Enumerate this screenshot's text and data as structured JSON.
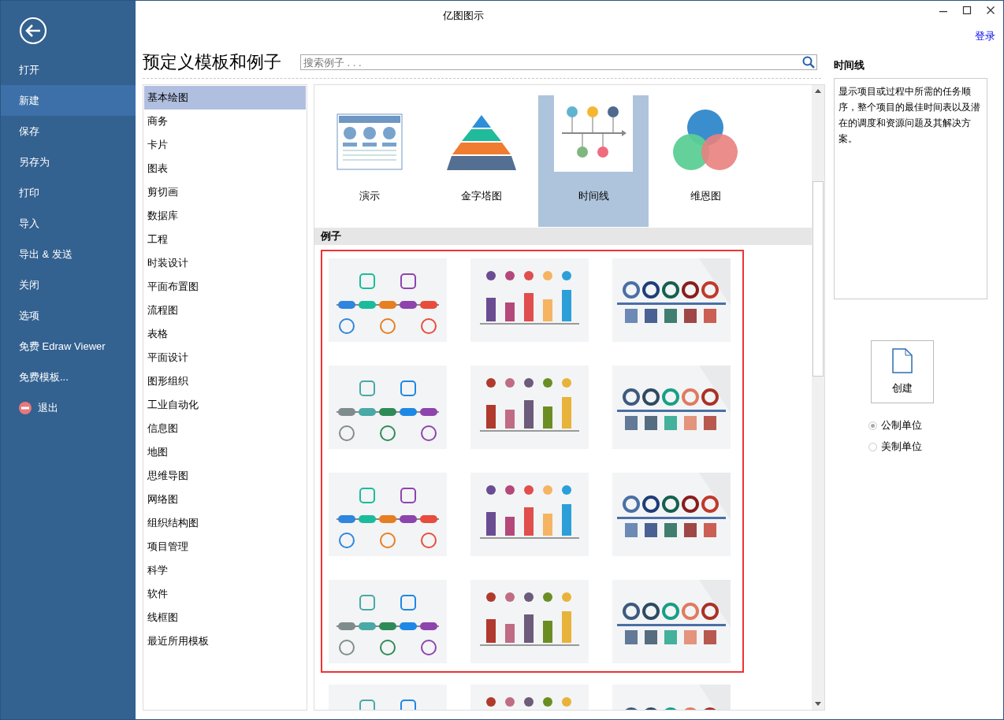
{
  "window": {
    "title": "亿图图示"
  },
  "account": {
    "login_link": "登录"
  },
  "sidebar": {
    "items": [
      {
        "label": "打开",
        "kind": "plain",
        "selected": false
      },
      {
        "label": "新建",
        "kind": "plain",
        "selected": true
      },
      {
        "label": "保存",
        "kind": "plain",
        "selected": false
      },
      {
        "label": "另存为",
        "kind": "plain",
        "selected": false
      },
      {
        "label": "打印",
        "kind": "plain",
        "selected": false
      },
      {
        "label": "导入",
        "kind": "plain",
        "selected": false
      },
      {
        "label": "导出 & 发送",
        "kind": "plain",
        "selected": false
      },
      {
        "label": "关闭",
        "kind": "plain",
        "selected": false
      },
      {
        "label": "选项",
        "kind": "plain",
        "selected": false
      },
      {
        "label": "免费 Edraw Viewer",
        "kind": "plain",
        "selected": false
      },
      {
        "label": "免费模板...",
        "kind": "plain",
        "selected": false
      },
      {
        "label": "退出",
        "kind": "exit",
        "selected": false
      }
    ]
  },
  "heading": "预定义模板和例子",
  "search": {
    "placeholder": "搜索例子 . . ."
  },
  "categories": [
    {
      "label": "基本绘图",
      "selected": true
    },
    {
      "label": "商务",
      "selected": false
    },
    {
      "label": "卡片",
      "selected": false
    },
    {
      "label": "图表",
      "selected": false
    },
    {
      "label": "剪切画",
      "selected": false
    },
    {
      "label": "数据库",
      "selected": false
    },
    {
      "label": "工程",
      "selected": false
    },
    {
      "label": "时装设计",
      "selected": false
    },
    {
      "label": "平面布置图",
      "selected": false
    },
    {
      "label": "流程图",
      "selected": false
    },
    {
      "label": "表格",
      "selected": false
    },
    {
      "label": "平面设计",
      "selected": false
    },
    {
      "label": "图形组织",
      "selected": false
    },
    {
      "label": "工业自动化",
      "selected": false
    },
    {
      "label": "信息图",
      "selected": false
    },
    {
      "label": "地图",
      "selected": false
    },
    {
      "label": "思维导图",
      "selected": false
    },
    {
      "label": "网络图",
      "selected": false
    },
    {
      "label": "组织结构图",
      "selected": false
    },
    {
      "label": "项目管理",
      "selected": false
    },
    {
      "label": "科学",
      "selected": false
    },
    {
      "label": "软件",
      "selected": false
    },
    {
      "label": "线框图",
      "selected": false
    },
    {
      "label": "最近所用模板",
      "selected": false
    }
  ],
  "templates": [
    {
      "label": "演示",
      "kind": "presentation",
      "selected": false
    },
    {
      "label": "金字塔图",
      "kind": "pyramid",
      "selected": false
    },
    {
      "label": "时间线",
      "kind": "timeline",
      "selected": true
    },
    {
      "label": "维恩图",
      "kind": "venn",
      "selected": false
    }
  ],
  "examples": {
    "header": "例子"
  },
  "detail": {
    "title": "时间线",
    "description": "显示项目或过程中所需的任务顺序，整个项目的最佳时间表以及潜在的调度和资源问题及其解决方案。"
  },
  "create_button": {
    "label": "创建"
  },
  "units": [
    {
      "label": "公制单位",
      "selected": true
    },
    {
      "label": "美制单位",
      "selected": false
    }
  ]
}
